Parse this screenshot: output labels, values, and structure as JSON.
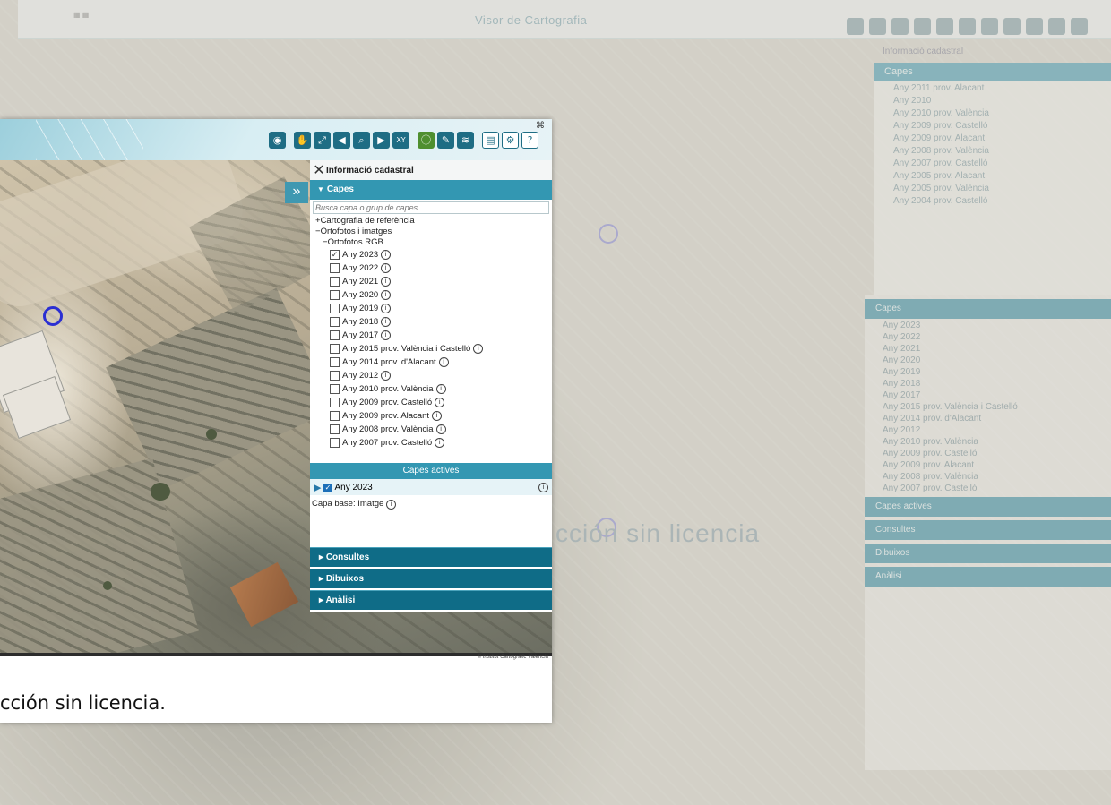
{
  "background_app": {
    "title": "Visor de Cartografia",
    "watermark": "cción sin licencia",
    "info_title": "Informació cadastral",
    "layers_header": "Capes",
    "layer_rows": [
      "Any 2011 prov. Alacant",
      "Any 2010",
      "Any 2010 prov. València",
      "Any 2009 prov. Castelló",
      "Any 2009 prov. Alacant",
      "Any 2008 prov. València",
      "Any 2007 prov. Castelló",
      "Any 2005 prov. Alacant",
      "Any 2005 prov. València",
      "Any 2004 prov. Castelló"
    ],
    "panel2_rows": [
      "Any 2023",
      "Any 2022",
      "Any 2021",
      "Any 2020",
      "Any 2019",
      "Any 2018",
      "Any 2017",
      "Any 2015 prov. València i Castelló",
      "Any 2014 prov. d'Alacant",
      "Any 2012",
      "Any 2010 prov. València",
      "Any 2009 prov. Castelló",
      "Any 2009 prov. Alacant",
      "Any 2008 prov. València",
      "Any 2007 prov. Castelló"
    ],
    "panel2_actives": "Capes actives",
    "panel2_accordion": [
      "Consultes",
      "Dibuixos",
      "Anàlisi"
    ]
  },
  "front": {
    "toolbar_icons": [
      "eye-icon",
      "hand-icon",
      "zoom-extent-icon",
      "back-icon",
      "zoom-icon",
      "forward-icon",
      "xy-icon",
      "info-icon",
      "measure-icon",
      "layers-icon",
      "print-icon",
      "settings-icon",
      "help-icon"
    ],
    "xy_label": "XY",
    "info_title": "Informació cadastral",
    "capes_header": "Capes",
    "search_placeholder": "Busca capa o grup de capes",
    "tree": {
      "group1": "Cartografia de referència",
      "group2": "Ortofotos i imatges",
      "subgroup": "Ortofotos RGB",
      "layers": [
        {
          "label": "Any 2023",
          "checked": true
        },
        {
          "label": "Any 2022",
          "checked": false
        },
        {
          "label": "Any 2021",
          "checked": false
        },
        {
          "label": "Any 2020",
          "checked": false
        },
        {
          "label": "Any 2019",
          "checked": false
        },
        {
          "label": "Any 2018",
          "checked": false
        },
        {
          "label": "Any 2017",
          "checked": false
        },
        {
          "label": "Any 2015 prov. València i Castelló",
          "checked": false
        },
        {
          "label": "Any 2014 prov. d'Alacant",
          "checked": false
        },
        {
          "label": "Any 2012",
          "checked": false
        },
        {
          "label": "Any 2010 prov. València",
          "checked": false
        },
        {
          "label": "Any 2009 prov. Castelló",
          "checked": false
        },
        {
          "label": "Any 2009 prov. Alacant",
          "checked": false
        },
        {
          "label": "Any 2008 prov. València",
          "checked": false
        },
        {
          "label": "Any 2007 prov. Castelló",
          "checked": false
        }
      ]
    },
    "actives_header": "Capes actives",
    "active_layer": "Any 2023",
    "capa_base": "Capa base: Imatge",
    "accordion": {
      "consultes": "Consultes",
      "dibuixos": "Dibuixos",
      "analisi": "Anàlisi"
    },
    "attribution": "© Institut Cartogràfic Valencià",
    "caption": "cción sin licencia."
  },
  "colors": {
    "accent": "#3397b2",
    "dark_accent": "#0f6c87",
    "marker": "#2b2fd2"
  }
}
